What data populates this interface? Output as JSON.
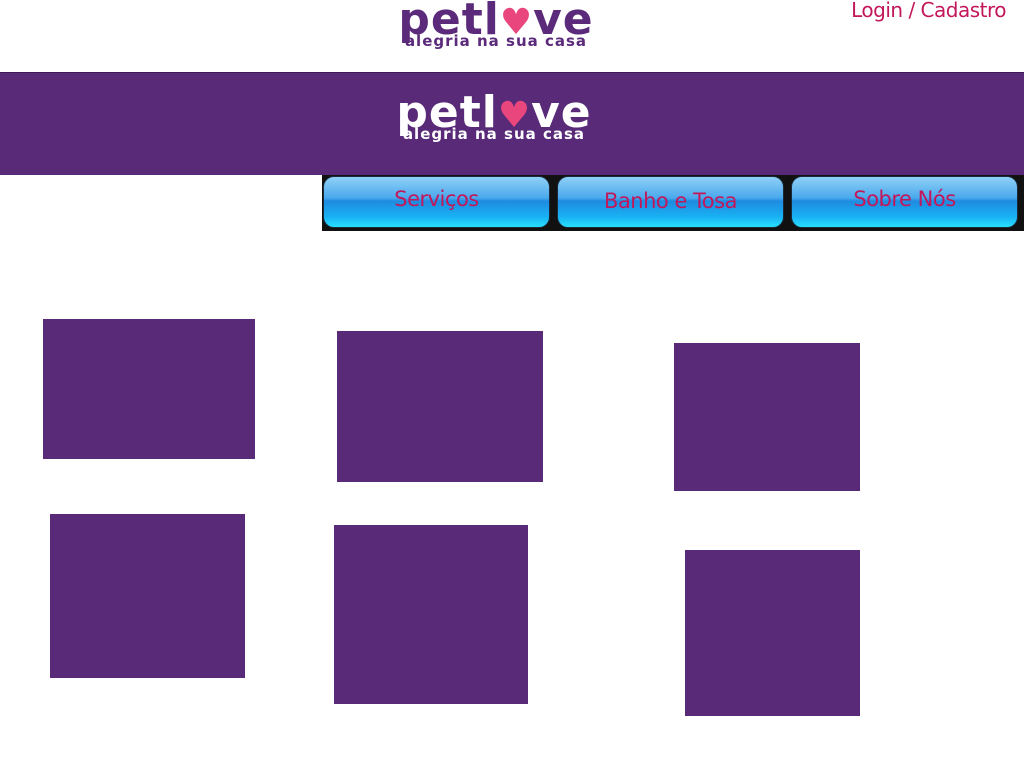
{
  "header": {
    "logo": {
      "wordmark_start": "petl",
      "wordmark_heart": "♥",
      "wordmark_end": "ve",
      "tagline": "alegria na sua casa"
    },
    "login_label": "Login / Cadastro"
  },
  "banner": {
    "logo": {
      "wordmark_start": "petl",
      "wordmark_heart": "♥",
      "wordmark_end": "ve",
      "tagline": "alegria na sua casa"
    }
  },
  "nav": {
    "items": [
      {
        "label": "Serviços"
      },
      {
        "label": "Banho e Tosa"
      },
      {
        "label": "Sobre Nós"
      }
    ]
  },
  "colors": {
    "brand_purple": "#582a77",
    "accent_pink": "#c2185b",
    "heart_pink": "#e8467c",
    "button_blue": "#1f8be0"
  }
}
